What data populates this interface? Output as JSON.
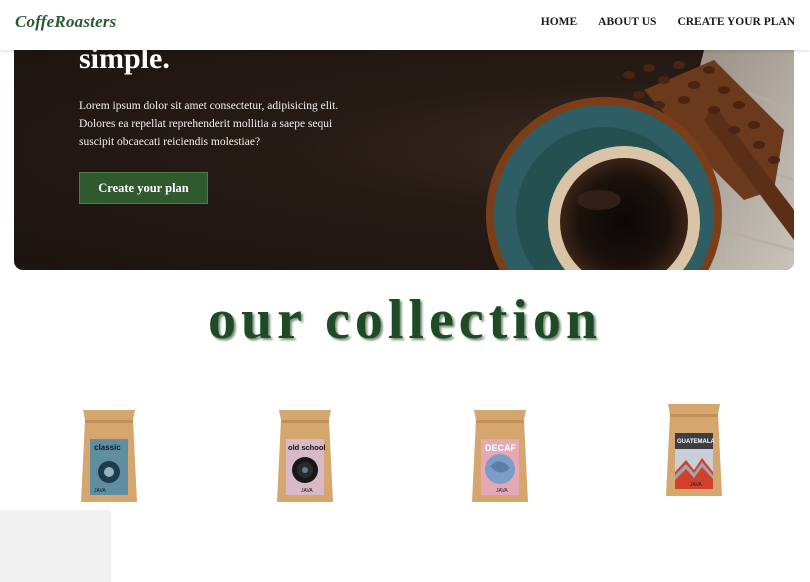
{
  "header": {
    "logo": "CoffeRoasters",
    "nav": [
      "HOME",
      "ABOUT US",
      "CREATE YOUR PLAN"
    ]
  },
  "hero": {
    "title": "simple.",
    "description": "Lorem ipsum dolor sit amet consectetur, adipisicing elit. Dolores ea repellat reprehenderit mollitia a saepe sequi suscipit obcaecati reiciendis molestiae?",
    "cta_label": "Create your plan"
  },
  "collection": {
    "title": "our collection",
    "products": [
      {
        "label": "classic",
        "brand": "JAVA",
        "accent": "#5f8ea1"
      },
      {
        "label": "old school",
        "brand": "JAVA",
        "accent": "#d8b9c7"
      },
      {
        "label": "DECAF",
        "brand": "JAVA",
        "accent": "#e4a9b4"
      },
      {
        "label": "GUATEMALA",
        "brand": "JAVA",
        "accent": "#c8cfd7"
      }
    ]
  },
  "colors": {
    "accent": "#2f5a30",
    "kraft": "#d5a66d"
  }
}
